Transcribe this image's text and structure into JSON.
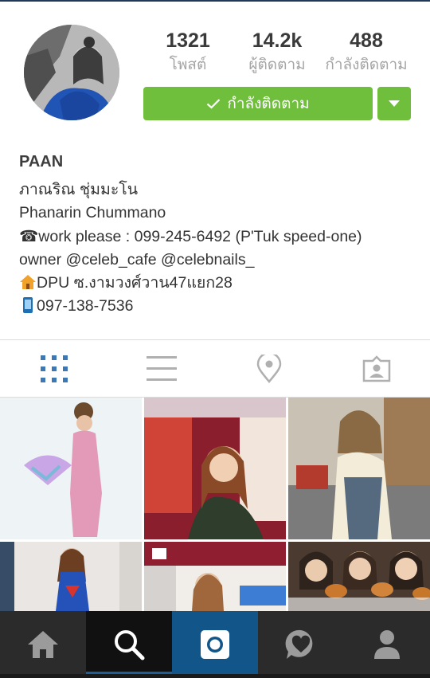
{
  "profile": {
    "stats": [
      {
        "value": "1321",
        "label": "โพสต์"
      },
      {
        "value": "14.2k",
        "label": "ผู้ติดตาม"
      },
      {
        "value": "488",
        "label": "กำลังติดตาม"
      }
    ],
    "follow_button_label": "กำลังติดตาม",
    "username": "PAAN",
    "bio_lines": [
      "ภาณริณ ชุ่มมะโน",
      "Phanarin Chummano",
      "☎work please : 099-245-6492 (P'Tuk speed-one)",
      "owner @celeb_cafe @celebnails_",
      "DPU ซ.งามวงศ์วาน47แยก28",
      "097-138-7536"
    ]
  },
  "tabs": [
    {
      "icon": "grid-icon",
      "active": true
    },
    {
      "icon": "list-icon",
      "active": false
    },
    {
      "icon": "location-pin-icon",
      "active": false
    },
    {
      "icon": "tagged-photos-icon",
      "active": false
    }
  ],
  "nav": [
    {
      "icon": "home-icon"
    },
    {
      "icon": "search-icon",
      "active": true
    },
    {
      "icon": "camera-icon"
    },
    {
      "icon": "activity-heart-icon"
    },
    {
      "icon": "profile-icon"
    }
  ],
  "colors": {
    "follow_green": "#6fbf3c",
    "active_tab_blue": "#3c78b4",
    "nav_bg": "#2b2b2b",
    "camera_blue": "#125689"
  }
}
